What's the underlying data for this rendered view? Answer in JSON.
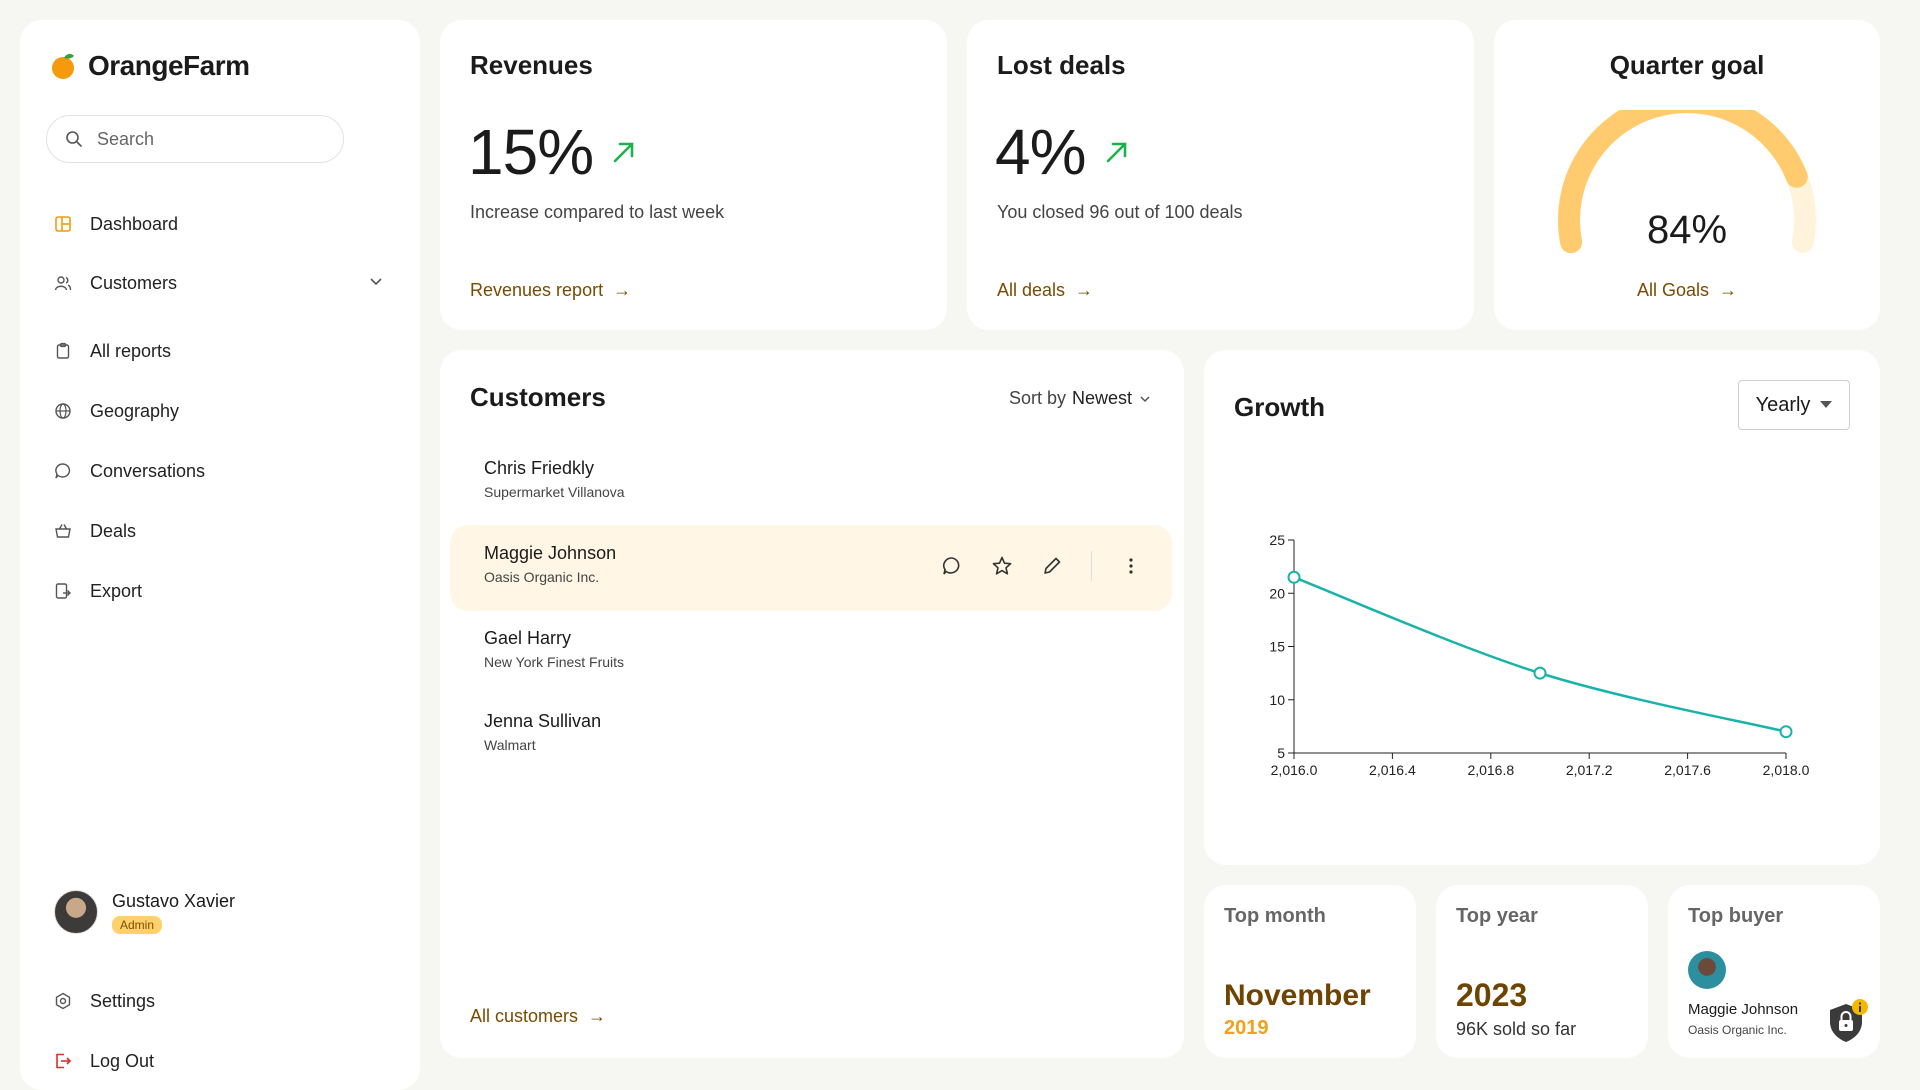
{
  "brand": {
    "name": "OrangeFarm"
  },
  "search": {
    "placeholder": "Search"
  },
  "nav": {
    "dashboard": "Dashboard",
    "customers": "Customers",
    "all_reports": "All reports",
    "geography": "Geography",
    "conversations": "Conversations",
    "deals": "Deals",
    "export": "Export"
  },
  "user": {
    "name": "Gustavo Xavier",
    "role": "Admin"
  },
  "footer_nav": {
    "settings": "Settings",
    "logout": "Log Out"
  },
  "revenues": {
    "title": "Revenues",
    "value": "15%",
    "desc": "Increase compared to last week",
    "link": "Revenues report"
  },
  "lost_deals": {
    "title": "Lost deals",
    "value": "4%",
    "desc": "You closed 96 out of 100 deals",
    "link": "All deals"
  },
  "quarter_goal": {
    "title": "Quarter goal",
    "value": "84%",
    "progress": 0.84,
    "link": "All Goals"
  },
  "customers": {
    "title": "Customers",
    "sort_prefix": "Sort by",
    "sort_value": "Newest",
    "rows": [
      {
        "name": "Chris Friedkly",
        "company": "Supermarket Villanova"
      },
      {
        "name": "Maggie Johnson",
        "company": "Oasis Organic Inc."
      },
      {
        "name": "Gael Harry",
        "company": "New York Finest Fruits"
      },
      {
        "name": "Jenna Sullivan",
        "company": "Walmart"
      }
    ],
    "link": "All customers"
  },
  "growth": {
    "title": "Growth",
    "period": "Yearly"
  },
  "chart_data": {
    "type": "line",
    "x": [
      2016.0,
      2017.0,
      2018.0
    ],
    "series": [
      {
        "values": [
          21.5,
          12.5,
          7.0
        ]
      }
    ],
    "xlim": [
      2016.0,
      2018.0
    ],
    "ylim": [
      5,
      25
    ],
    "xticks": [
      "2,016.0",
      "2,016.4",
      "2,016.8",
      "2,017.2",
      "2,017.6",
      "2,018.0"
    ],
    "yticks": [
      "5",
      "10",
      "15",
      "20",
      "25"
    ],
    "color": "#1ab3aa"
  },
  "top_month": {
    "title": "Top month",
    "value": "November",
    "sub": "2019"
  },
  "top_year": {
    "title": "Top year",
    "value": "2023",
    "sub": "96K sold so far"
  },
  "top_buyer": {
    "title": "Top buyer",
    "name": "Maggie Johnson",
    "company": "Oasis Organic Inc."
  }
}
